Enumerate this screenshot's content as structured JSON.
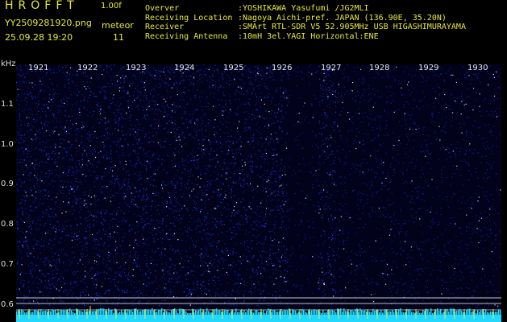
{
  "header": {
    "app_title": "HROFFT",
    "version": "1.00f",
    "filename": "YY2509281920.png",
    "mode": "meteor",
    "timestamp": "25.09.28 19:20",
    "count": "11"
  },
  "info": [
    {
      "key": "Overver",
      "value": ":YOSHIKAWA Yasufumi /JG2MLI"
    },
    {
      "key": "Receiving Location",
      "value": ":Nagoya Aichi-pref. JAPAN (136.90E, 35.20N)"
    },
    {
      "key": "Receiver",
      "value": ":SMArt RTL-SDR V5 52.905MHz USB HIGASHIMURAYAMA"
    },
    {
      "key": "Receiving Antenna",
      "value": ":10mH 3el.YAGI Horizontal:ENE"
    }
  ],
  "axis": {
    "y_unit": "kHz",
    "y_ticks": [
      "1.1",
      "1.0",
      "0.9",
      "0.8",
      "0.7",
      "0.6"
    ],
    "x_ticks": [
      "1921",
      "1922",
      "1923",
      "1924",
      "1925",
      "1926",
      "1927",
      "1928",
      "1929",
      "1930"
    ]
  },
  "colors": {
    "header_text": "#e8e83a",
    "noise_dense": "#1c3cff",
    "noise_sparse": "#0a1ab8",
    "baseline": "#22d8ff"
  }
}
